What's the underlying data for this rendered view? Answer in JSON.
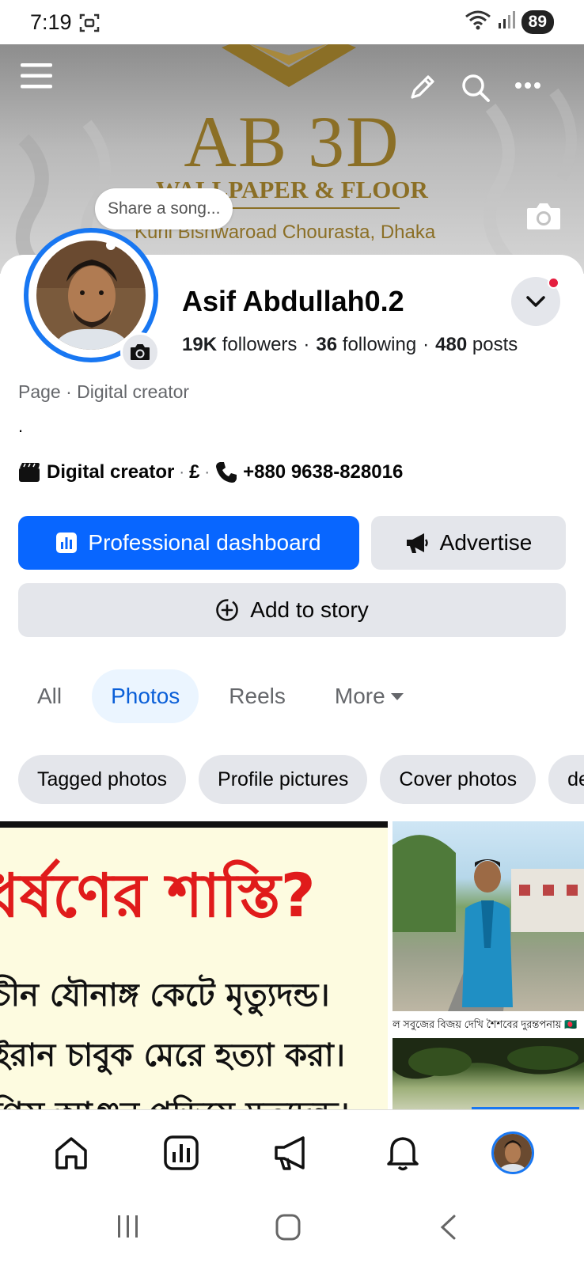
{
  "status_bar": {
    "time": "7:19",
    "battery": "89"
  },
  "cover": {
    "brand_title": "AB 3D",
    "brand_subtitle": "WALLPAPER & FLOOR",
    "brand_address": "Kuril Bishwaroad Chourasta, Dhaka"
  },
  "song_bubble": "Share a song...",
  "profile": {
    "name": "Asif Abdullah0.2",
    "followers_count": "19K",
    "followers_label": "followers",
    "following_count": "36",
    "following_label": "following",
    "posts_count": "480",
    "posts_label": "posts",
    "page_type": "Page · Digital creator",
    "bio": ".",
    "category": "Digital creator",
    "currency_symbol": "£",
    "phone": "+880 9638-828016"
  },
  "buttons": {
    "dashboard": "Professional dashboard",
    "advertise": "Advertise",
    "add_story": "Add to story"
  },
  "tabs": [
    {
      "label": "All",
      "active": false
    },
    {
      "label": "Photos",
      "active": true
    },
    {
      "label": "Reels",
      "active": false
    },
    {
      "label": "More",
      "active": false
    }
  ],
  "chips": [
    "Tagged photos",
    "Profile pictures",
    "Cover photos",
    "de"
  ],
  "photos": {
    "big_title": "ধর্ষণের শাস্তি?",
    "big_lines": [
      "চীন যৌনাঙ্গ কেটে মৃত্যুদন্ড।",
      "ইরান চাবুক মেরে হত্যা করা।",
      "গিস আগুন পুড়িয়ে মৃত্যুদন্ড।"
    ],
    "small_caption": "ল সবুজের বিজয় দেখি শৈশবের দুরন্তপনায় 🇧🇩"
  },
  "colors": {
    "accent": "#0866ff",
    "active_tab_bg": "#ebf5ff",
    "chip_bg": "#e4e6eb",
    "brand_gold": "#8b6f26",
    "notification": "#e41e3f"
  },
  "icons": [
    "menu-icon",
    "edit-icon",
    "search-icon",
    "more-icon",
    "camera-icon",
    "chevron-down-icon",
    "clapper-icon",
    "phone-icon",
    "chart-icon",
    "megaphone-icon",
    "add-circle-icon",
    "caret-down-icon",
    "home-icon",
    "dashboard-icon",
    "bell-icon"
  ]
}
